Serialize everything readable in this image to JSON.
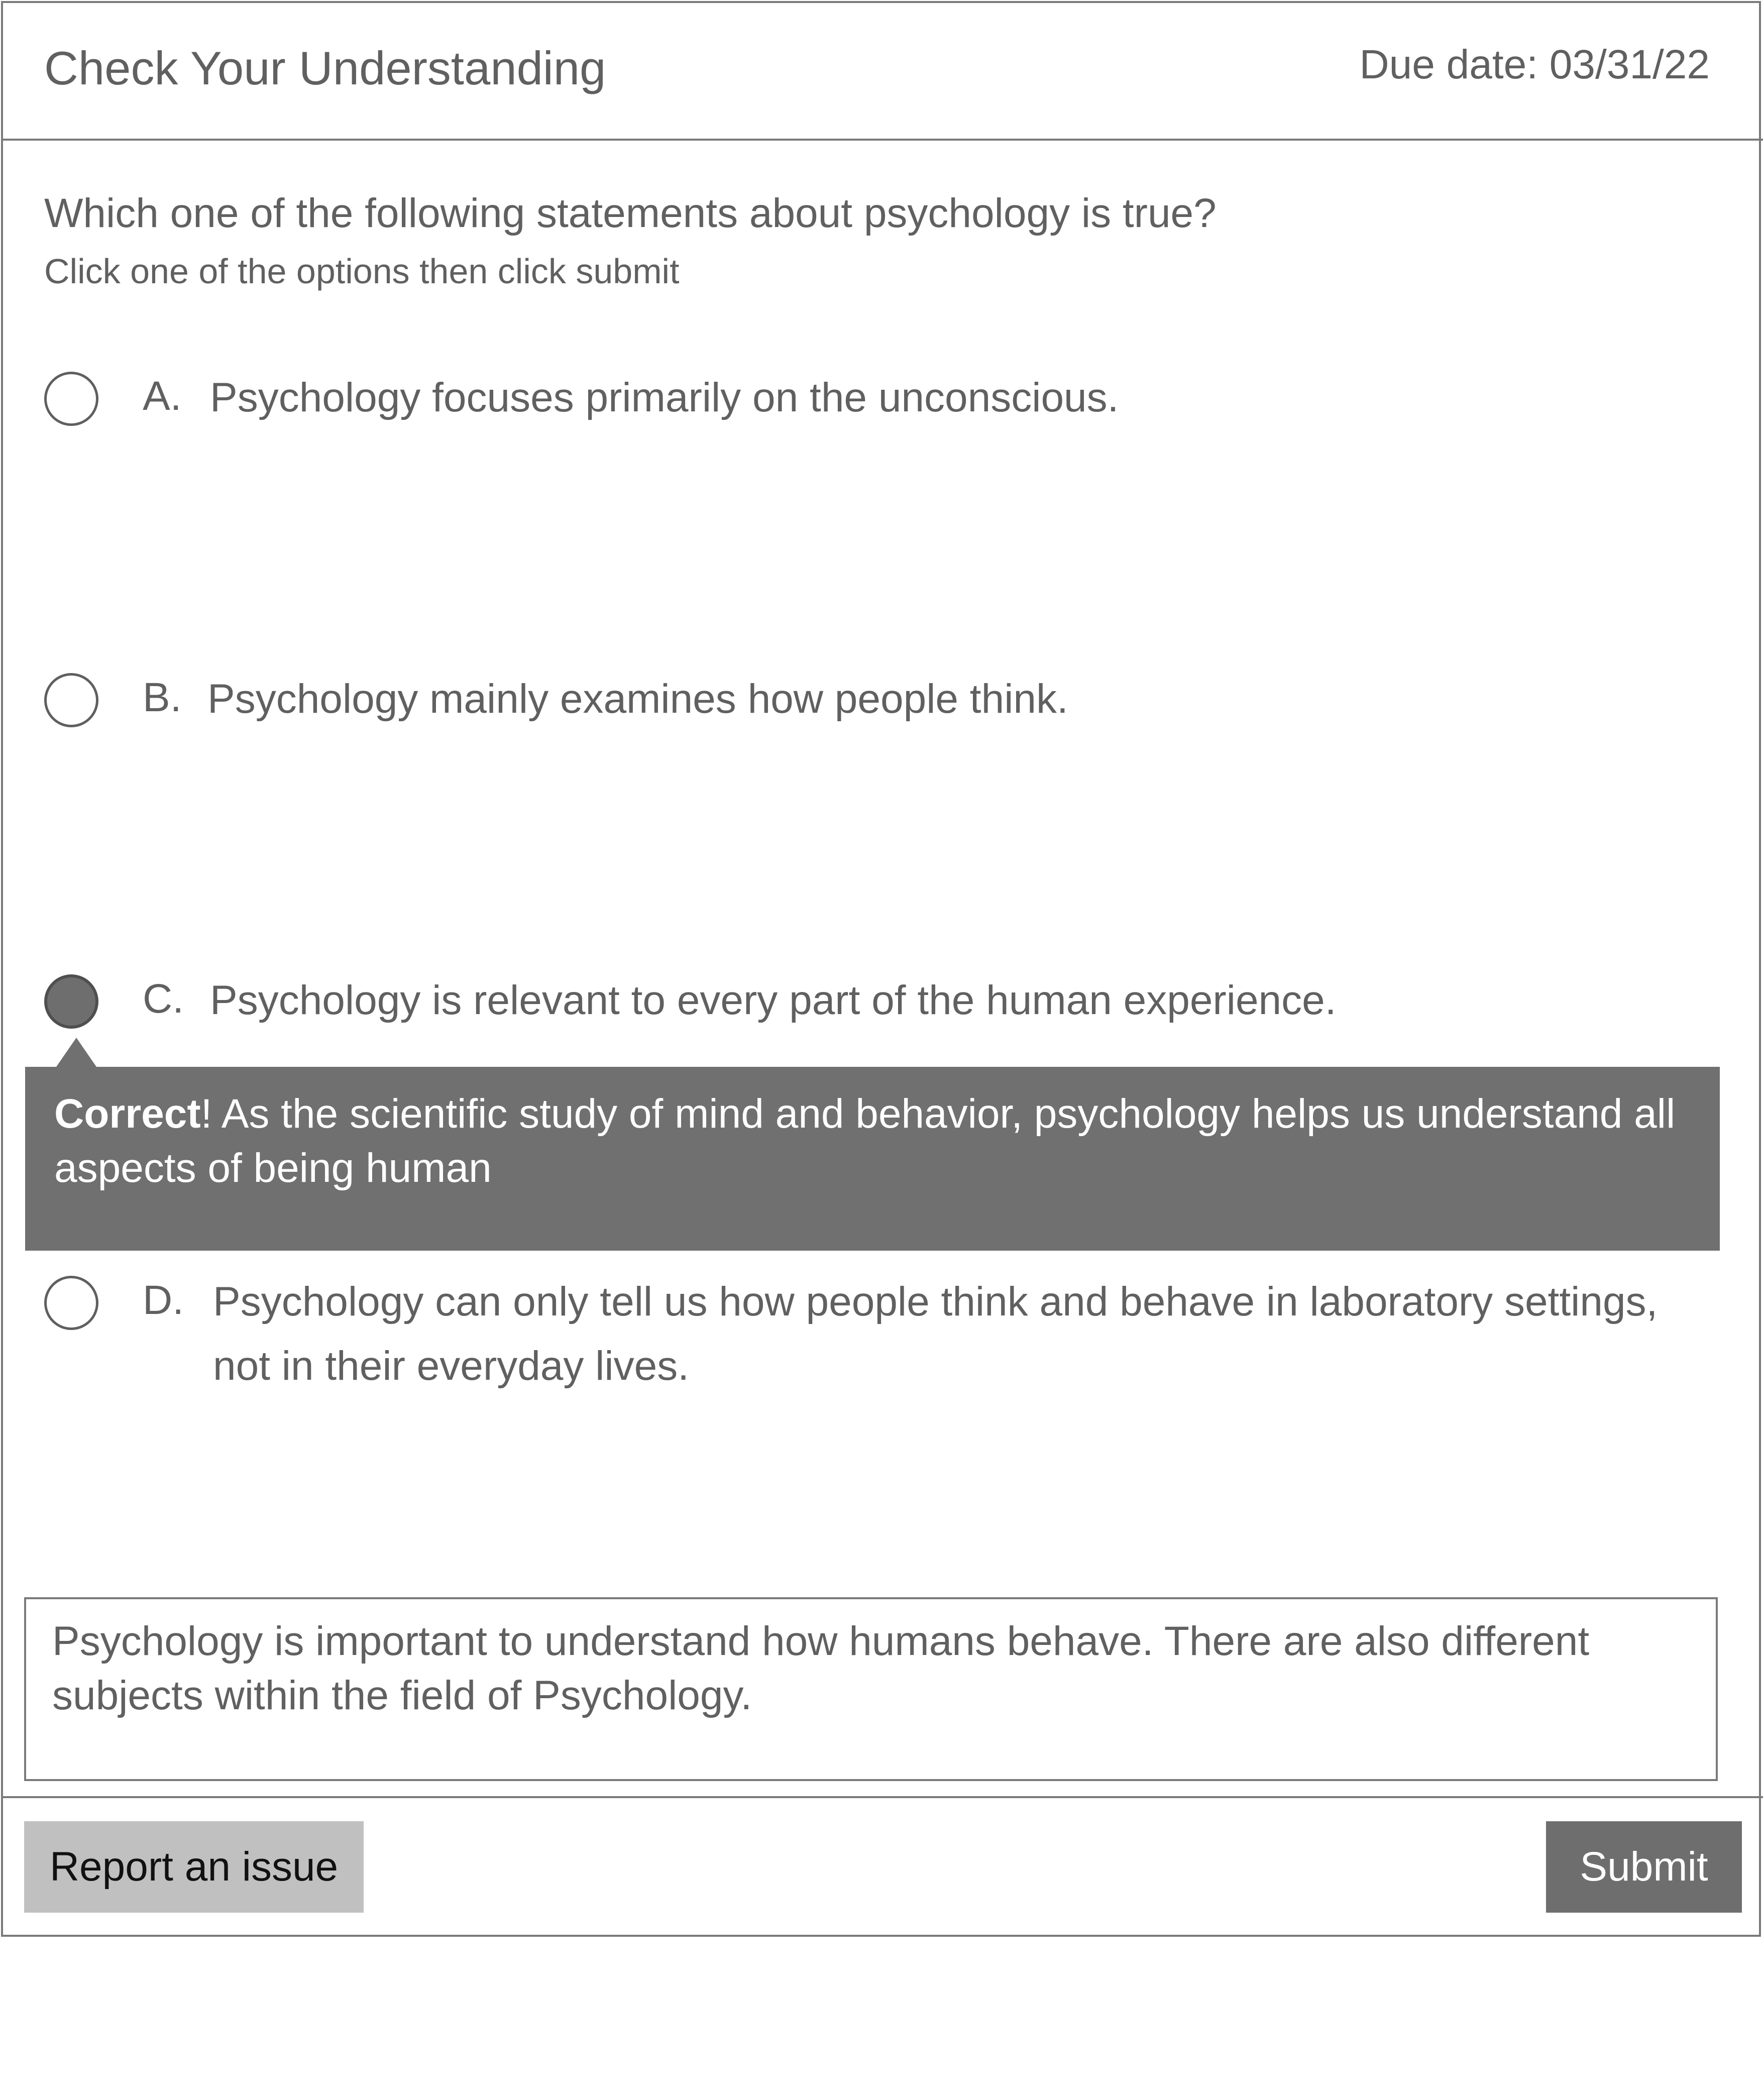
{
  "header": {
    "title": "Check Your Understanding",
    "due_date": "Due date: 03/31/22"
  },
  "question": {
    "prompt": "Which one of the following statements about psychology is true?",
    "instruction": "Click one of the options then click submit"
  },
  "options": [
    {
      "letter": "A.",
      "text": "Psychology focuses primarily on the unconscious.",
      "selected": false
    },
    {
      "letter": "B.",
      "text": "Psychology mainly examines how people think.",
      "selected": false
    },
    {
      "letter": "C.",
      "text": "Psychology is relevant to every part of the human experience.",
      "selected": true
    },
    {
      "letter": "D.",
      "text_line1": "Psychology can only tell us how people think and behave in laboratory settings,",
      "text_line2": "not in their everyday lives.",
      "selected": false
    }
  ],
  "feedback": {
    "label": "Correct",
    "message": "! As the scientific study of mind and behavior, psychology helps us understand all",
    "message_line2": "aspects of being human"
  },
  "response": {
    "value": "Psychology is important to understand how humans behave. There are also different subjects within the field of Psychology."
  },
  "footer": {
    "report_label": "Report an issue",
    "submit_label": "Submit"
  }
}
